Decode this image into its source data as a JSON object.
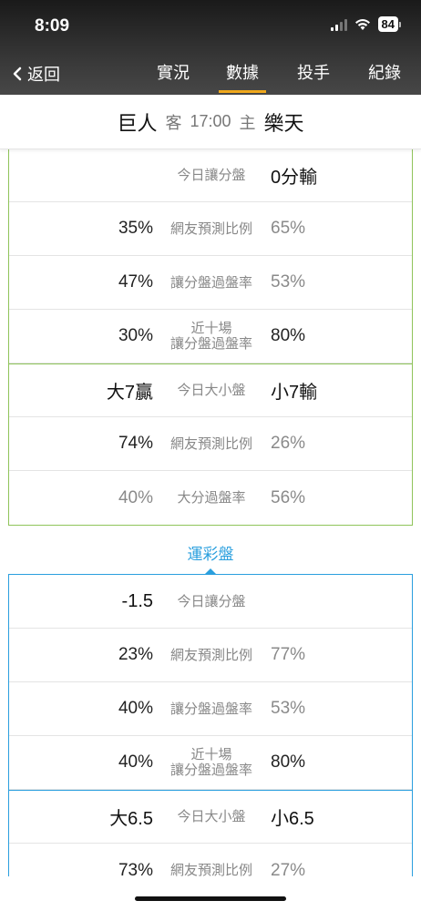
{
  "status_bar": {
    "time": "8:09",
    "battery": "84"
  },
  "nav": {
    "back_label": "返回",
    "tabs": [
      {
        "label": "實況",
        "active": false
      },
      {
        "label": "數據",
        "active": true
      },
      {
        "label": "投手",
        "active": false
      },
      {
        "label": "紀錄",
        "active": false
      }
    ]
  },
  "matchup": {
    "away_team": "巨人",
    "away_tag": "客",
    "time": "17:00",
    "home_tag": "主",
    "home_team": "樂天"
  },
  "panel1": {
    "rows": [
      {
        "left": "",
        "label": "今日讓分盤",
        "label2": "",
        "right": "0分輸"
      },
      {
        "left": "35%",
        "label": "網友預測比例",
        "label2": "",
        "right": "65%"
      },
      {
        "left": "47%",
        "label": "讓分盤過盤率",
        "label2": "",
        "right": "53%"
      },
      {
        "left": "30%",
        "label": "近十場",
        "label2": "讓分盤過盤率",
        "right": "80%"
      },
      {
        "left": "大7贏",
        "label": "今日大小盤",
        "label2": "",
        "right": "小7輸"
      },
      {
        "left": "74%",
        "label": "網友預測比例",
        "label2": "",
        "right": "26%"
      },
      {
        "left": "40%",
        "label": "大分過盤率",
        "label2": "",
        "right": "56%"
      }
    ]
  },
  "section2": {
    "title": "運彩盤"
  },
  "panel2": {
    "rows": [
      {
        "left": "-1.5",
        "label": "今日讓分盤",
        "label2": "",
        "right": ""
      },
      {
        "left": "23%",
        "label": "網友預測比例",
        "label2": "",
        "right": "77%"
      },
      {
        "left": "40%",
        "label": "讓分盤過盤率",
        "label2": "",
        "right": "53%"
      },
      {
        "left": "40%",
        "label": "近十場",
        "label2": "讓分盤過盤率",
        "right": "80%"
      },
      {
        "left": "大6.5",
        "label": "今日大小盤",
        "label2": "",
        "right": "小6.5"
      },
      {
        "left": "73%",
        "label": "網友預測比例",
        "label2": "",
        "right": "27%"
      }
    ]
  },
  "colors": {
    "accent": "#f0a81c",
    "green_border": "#8fc45a",
    "blue": "#2a9fde"
  }
}
